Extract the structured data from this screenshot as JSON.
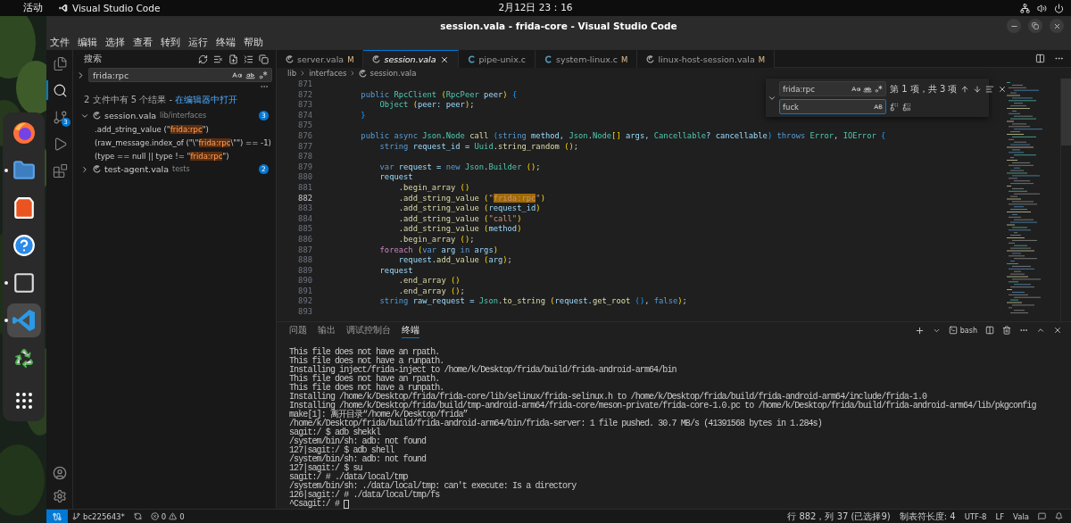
{
  "top_bar": {
    "activities": "活动",
    "app_name": "Visual Studio Code",
    "clock": "2月12日 23：16"
  },
  "dock": [
    {
      "kind": "firefox",
      "running": false,
      "selected": false
    },
    {
      "kind": "files",
      "running": true,
      "selected": false
    },
    {
      "kind": "software",
      "running": false,
      "selected": false
    },
    {
      "kind": "help",
      "running": false,
      "selected": false
    },
    {
      "kind": "terminal",
      "running": true,
      "selected": false
    },
    {
      "kind": "vscode",
      "running": true,
      "selected": true
    },
    {
      "kind": "trash",
      "running": false,
      "selected": false
    },
    {
      "kind": "apps",
      "running": false,
      "selected": false
    }
  ],
  "window": {
    "title": "session.vala - frida-core - Visual Studio Code"
  },
  "menu": [
    "文件",
    "编辑",
    "选择",
    "查看",
    "转到",
    "运行",
    "终端",
    "帮助"
  ],
  "activity_bar": [
    {
      "kind": "explorer",
      "selected": false
    },
    {
      "kind": "search",
      "selected": true
    },
    {
      "kind": "source_control",
      "selected": false,
      "badge": "3"
    },
    {
      "kind": "run",
      "selected": false
    },
    {
      "kind": "extensions",
      "selected": false
    }
  ],
  "sidebar": {
    "title": "搜索",
    "query": "frida:rpc",
    "summary": "2 文件中有 5 个结果 -",
    "open_link": "在编辑器中打开",
    "results": [
      {
        "file": "session.vala",
        "path": "lib/interfaces",
        "count": "3",
        "expanded": true,
        "matches": [
          [
            {
              "text": ".add_string_value (\"",
              "match": false
            },
            {
              "text": "frida:rpc",
              "match": true
            },
            {
              "text": "\")",
              "match": false
            }
          ],
          [
            {
              "text": "(raw_message.index_of (\"\\\"",
              "match": false
            },
            {
              "text": "frida:rpc",
              "match": true
            },
            {
              "text": "\\\"\") == -1)",
              "match": false
            }
          ],
          [
            {
              "text": "(type == null || type != \"",
              "match": false
            },
            {
              "text": "frida:rpc",
              "match": true
            },
            {
              "text": "\")",
              "match": false
            }
          ]
        ]
      },
      {
        "file": "test-agent.vala",
        "path": "tests",
        "count": "2",
        "expanded": false
      }
    ]
  },
  "tabs": [
    {
      "label": "server.vala",
      "kind": "vala",
      "status": "M",
      "selected": false,
      "preview": false
    },
    {
      "label": "session.vala",
      "kind": "vala",
      "selected": true,
      "preview": true
    },
    {
      "label": "pipe-unix.c",
      "kind": "c",
      "selected": false,
      "preview": false
    },
    {
      "label": "system-linux.c",
      "kind": "c",
      "status": "M",
      "selected": false,
      "preview": false
    },
    {
      "label": "linux-host-session.vala",
      "kind": "vala",
      "status": "M",
      "selected": false,
      "preview": false
    }
  ],
  "breadcrumbs": [
    "lib",
    "interfaces",
    "session.vala"
  ],
  "find": {
    "query": "frida:rpc",
    "result": "第 1 项，共 3 项",
    "replace": "fuck",
    "expanded": true
  },
  "code": [
    {
      "number": "871",
      "current": false
    },
    {
      "number": "872",
      "current": false,
      "tokens": [
        {
          "text": "        public ",
          "kind": "kw"
        },
        {
          "text": "RpcClient ",
          "kind": "type"
        },
        {
          "text": "(",
          "kind": "br"
        },
        {
          "text": "RpcPeer",
          "kind": "type"
        },
        {
          "text": " peer",
          "kind": "var"
        },
        {
          "text": ") ",
          "kind": "br"
        },
        {
          "text": "{",
          "kind": "br2"
        }
      ]
    },
    {
      "number": "873",
      "current": false,
      "tokens": [
        {
          "text": "            Object ",
          "kind": "type"
        },
        {
          "text": "(",
          "kind": "br"
        },
        {
          "text": "peer: peer",
          "kind": "var"
        },
        {
          "text": ")",
          "kind": "br"
        },
        {
          "text": ";",
          "kind": "p"
        }
      ]
    },
    {
      "number": "874",
      "current": false,
      "tokens": [
        {
          "text": "        }",
          "kind": "br2"
        }
      ]
    },
    {
      "number": "875",
      "current": false
    },
    {
      "number": "876",
      "current": false,
      "tokens": [
        {
          "text": "        public async ",
          "kind": "kw"
        },
        {
          "text": "Json",
          "kind": "type"
        },
        {
          "text": ".",
          "kind": "p"
        },
        {
          "text": "Node ",
          "kind": "type"
        },
        {
          "text": "call ",
          "kind": "fn"
        },
        {
          "text": "(",
          "kind": "br2"
        },
        {
          "text": "string",
          "kind": "kw"
        },
        {
          "text": " method, ",
          "kind": "var"
        },
        {
          "text": "Json",
          "kind": "type"
        },
        {
          "text": ".",
          "kind": "p"
        },
        {
          "text": "Node",
          "kind": "type"
        },
        {
          "text": "[]",
          "kind": "br"
        },
        {
          "text": " args, ",
          "kind": "var"
        },
        {
          "text": "Cancellable",
          "kind": "type"
        },
        {
          "text": "? cancellable",
          "kind": "var"
        },
        {
          "text": ") ",
          "kind": "br2"
        },
        {
          "text": "throws ",
          "kind": "kw"
        },
        {
          "text": "Error",
          "kind": "type"
        },
        {
          "text": ", ",
          "kind": "p"
        },
        {
          "text": "IOError ",
          "kind": "type"
        },
        {
          "text": "{",
          "kind": "br2"
        }
      ]
    },
    {
      "number": "877",
      "current": false,
      "tokens": [
        {
          "text": "            string",
          "kind": "kw"
        },
        {
          "text": " request_id = ",
          "kind": "var"
        },
        {
          "text": "Uuid",
          "kind": "type"
        },
        {
          "text": ".",
          "kind": "p"
        },
        {
          "text": "string_random ",
          "kind": "fn"
        },
        {
          "text": "()",
          "kind": "br"
        },
        {
          "text": ";",
          "kind": "p"
        }
      ]
    },
    {
      "number": "878",
      "current": false
    },
    {
      "number": "879",
      "current": false,
      "tokens": [
        {
          "text": "            var",
          "kind": "kw"
        },
        {
          "text": " request = ",
          "kind": "var"
        },
        {
          "text": "new ",
          "kind": "kw"
        },
        {
          "text": "Json",
          "kind": "type"
        },
        {
          "text": ".",
          "kind": "p"
        },
        {
          "text": "Builder ",
          "kind": "type"
        },
        {
          "text": "()",
          "kind": "br"
        },
        {
          "text": ";",
          "kind": "p"
        }
      ]
    },
    {
      "number": "880",
      "current": false,
      "tokens": [
        {
          "text": "            request",
          "kind": "var"
        }
      ]
    },
    {
      "number": "881",
      "current": false,
      "tokens": [
        {
          "text": "                .",
          "kind": "p"
        },
        {
          "text": "begin_array ",
          "kind": "fn"
        },
        {
          "text": "()",
          "kind": "br"
        }
      ]
    },
    {
      "number": "882",
      "current": true,
      "tokens": [
        {
          "text": "                .",
          "kind": "p"
        },
        {
          "text": "add_string_value ",
          "kind": "fn"
        },
        {
          "text": "(",
          "kind": "br"
        },
        {
          "text": "\"",
          "kind": "str"
        },
        {
          "text": "frida:rpc",
          "kind": "match"
        },
        {
          "text": "\"",
          "kind": "str"
        },
        {
          "text": ")",
          "kind": "br"
        }
      ]
    },
    {
      "number": "883",
      "current": false,
      "tokens": [
        {
          "text": "                .",
          "kind": "p"
        },
        {
          "text": "add_string_value ",
          "kind": "fn"
        },
        {
          "text": "(",
          "kind": "br"
        },
        {
          "text": "request_id",
          "kind": "var"
        },
        {
          "text": ")",
          "kind": "br"
        }
      ]
    },
    {
      "number": "884",
      "current": false,
      "tokens": [
        {
          "text": "                .",
          "kind": "p"
        },
        {
          "text": "add_string_value ",
          "kind": "fn"
        },
        {
          "text": "(",
          "kind": "br"
        },
        {
          "text": "\"call\"",
          "kind": "str"
        },
        {
          "text": ")",
          "kind": "br"
        }
      ]
    },
    {
      "number": "885",
      "current": false,
      "tokens": [
        {
          "text": "                .",
          "kind": "p"
        },
        {
          "text": "add_string_value ",
          "kind": "fn"
        },
        {
          "text": "(",
          "kind": "br"
        },
        {
          "text": "method",
          "kind": "var"
        },
        {
          "text": ")",
          "kind": "br"
        }
      ]
    },
    {
      "number": "886",
      "current": false,
      "tokens": [
        {
          "text": "                .",
          "kind": "p"
        },
        {
          "text": "begin_array ",
          "kind": "fn"
        },
        {
          "text": "()",
          "kind": "br"
        },
        {
          "text": ";",
          "kind": "p"
        }
      ]
    },
    {
      "number": "887",
      "current": false,
      "tokens": [
        {
          "text": "            foreach ",
          "kind": "ctl"
        },
        {
          "text": "(",
          "kind": "br"
        },
        {
          "text": "var",
          "kind": "kw"
        },
        {
          "text": " arg ",
          "kind": "var"
        },
        {
          "text": "in",
          "kind": "kw"
        },
        {
          "text": " args",
          "kind": "var"
        },
        {
          "text": ")",
          "kind": "br"
        }
      ]
    },
    {
      "number": "888",
      "current": false,
      "tokens": [
        {
          "text": "                request.",
          "kind": "var"
        },
        {
          "text": "add_value ",
          "kind": "fn"
        },
        {
          "text": "(",
          "kind": "br"
        },
        {
          "text": "arg",
          "kind": "var"
        },
        {
          "text": ")",
          "kind": "br"
        },
        {
          "text": ";",
          "kind": "p"
        }
      ]
    },
    {
      "number": "889",
      "current": false,
      "tokens": [
        {
          "text": "            request",
          "kind": "var"
        }
      ]
    },
    {
      "number": "890",
      "current": false,
      "tokens": [
        {
          "text": "                .",
          "kind": "p"
        },
        {
          "text": "end_array ",
          "kind": "fn"
        },
        {
          "text": "()",
          "kind": "br"
        }
      ]
    },
    {
      "number": "891",
      "current": false,
      "tokens": [
        {
          "text": "                .",
          "kind": "p"
        },
        {
          "text": "end_array ",
          "kind": "fn"
        },
        {
          "text": "()",
          "kind": "br"
        },
        {
          "text": ";",
          "kind": "p"
        }
      ]
    },
    {
      "number": "892",
      "current": false,
      "tokens": [
        {
          "text": "            string",
          "kind": "kw"
        },
        {
          "text": " raw_request = ",
          "kind": "var"
        },
        {
          "text": "Json",
          "kind": "type"
        },
        {
          "text": ".",
          "kind": "p"
        },
        {
          "text": "to_string ",
          "kind": "fn"
        },
        {
          "text": "(",
          "kind": "br"
        },
        {
          "text": "request.",
          "kind": "var"
        },
        {
          "text": "get_root ",
          "kind": "fn"
        },
        {
          "text": "()",
          "kind": "br2"
        },
        {
          "text": ", ",
          "kind": "p"
        },
        {
          "text": "false",
          "kind": "kw"
        },
        {
          "text": ")",
          "kind": "br"
        },
        {
          "text": ";",
          "kind": "p"
        }
      ]
    },
    {
      "number": "893",
      "current": false
    }
  ],
  "panel": {
    "tabs": [
      {
        "label": "问题",
        "selected": false
      },
      {
        "label": "输出",
        "selected": false
      },
      {
        "label": "调试控制台",
        "selected": false
      },
      {
        "label": "终端",
        "selected": true
      }
    ],
    "shell": "bash",
    "terminal": [
      "This file does not have an rpath.",
      "This file does not have a runpath.",
      "Installing inject/frida-inject to /home/k/Desktop/frida/build/frida-android-arm64/bin",
      "This file does not have an rpath.",
      "This file does not have a runpath.",
      "Installing /home/k/Desktop/frida/frida-core/lib/selinux/frida-selinux.h to /home/k/Desktop/frida/build/frida-android-arm64/include/frida-1.0",
      "Installing /home/k/Desktop/frida/build/tmp-android-arm64/frida-core/meson-private/frida-core-1.0.pc to /home/k/Desktop/frida/build/frida-android-arm64/lib/pkgconfig",
      "make[1]: 离开目录“/home/k/Desktop/frida”",
      "/home/k/Desktop/frida/build/frida-android-arm64/bin/frida-server: 1 file pushed. 30.7 MB/s (41391568 bytes in 1.284s)",
      "sagit:/ $ adb shekkl",
      "/system/bin/sh: adb: not found",
      "127|sagit:/ $ adb shell",
      "/system/bin/sh: adb: not found",
      "127|sagit:/ $ su",
      "sagit:/ # ./data/local/tmp",
      "/system/bin/sh: ./data/local/tmp: can't execute: Is a directory",
      "126|sagit:/ # ./data/local/tmp/fs",
      "^Csagit:/ #"
    ]
  },
  "status_bar": {
    "branch": "bc225643*",
    "errors": "0",
    "warnings": "0",
    "position": "行 882，列 37 (已选择9)",
    "indent": "制表符长度: 4",
    "encoding": "UTF-8",
    "eol": "LF",
    "language": "Vala"
  }
}
